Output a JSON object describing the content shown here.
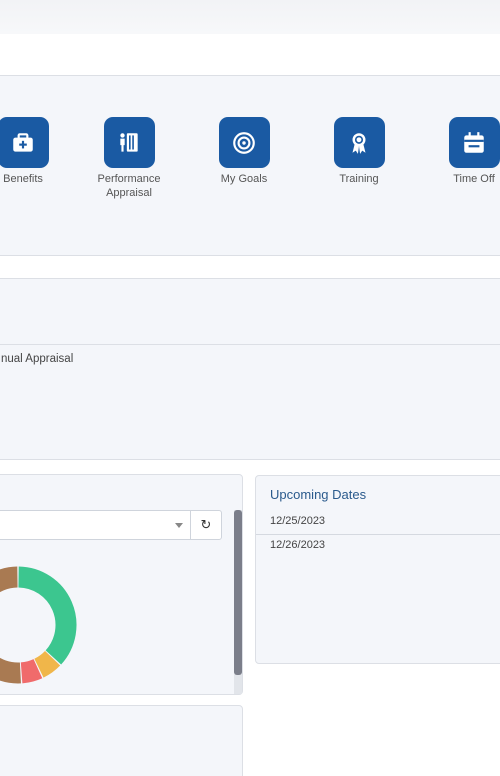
{
  "quick_links": [
    {
      "label": "Benefits",
      "icon": "medical-kit-icon"
    },
    {
      "label": "Performance Appraisal",
      "icon": "performance-appraisal-icon"
    },
    {
      "label": "My Goals",
      "icon": "target-icon"
    },
    {
      "label": "Training",
      "icon": "award-icon"
    },
    {
      "label": "Time Off",
      "icon": "calendar-icon"
    }
  ],
  "appraisal": {
    "item": "nual Appraisal"
  },
  "chart_card": {
    "select_value": "",
    "refresh_icon": "refresh-icon"
  },
  "chart_data": {
    "type": "pie",
    "slices": [
      {
        "value": 37,
        "color": "#3cc68f"
      },
      {
        "value": 6,
        "color": "#f0b64a"
      },
      {
        "value": 6,
        "color": "#f06b6b"
      },
      {
        "value": 51,
        "color": "#a97a52"
      }
    ]
  },
  "upcoming_dates": {
    "title": "Upcoming Dates",
    "dates": [
      "12/25/2023",
      "12/26/2023"
    ]
  },
  "colors": {
    "accent": "#1a5aa3",
    "panel_bg": "#f4f6fa",
    "title_blue": "#2a5a8c"
  }
}
